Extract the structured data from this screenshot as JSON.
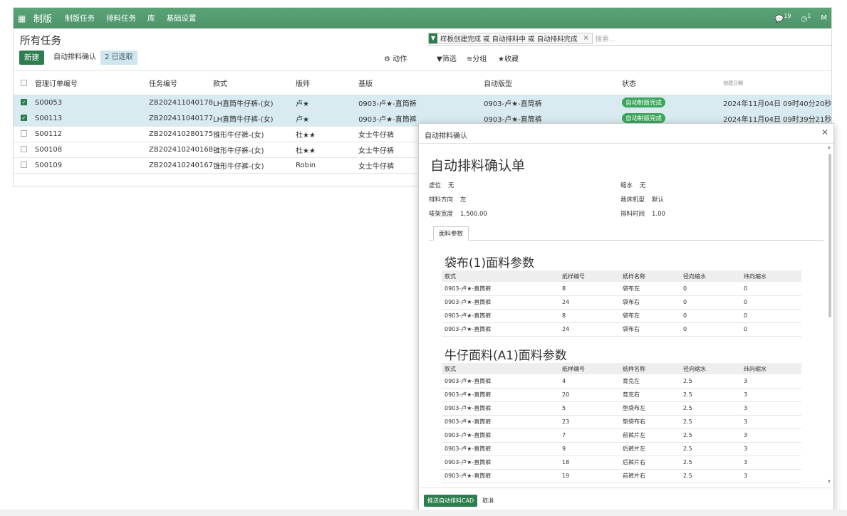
{
  "nav": {
    "brand": "制版",
    "items": [
      "制版任务",
      "排料任务",
      "库",
      "基础设置"
    ],
    "messages_count": "19",
    "activity_count": "1",
    "user_initial": "M"
  },
  "control": {
    "title": "所有任务",
    "new_label": "新建",
    "auto_confirm_label": "自动排料确认",
    "selected_label": "2 已选取",
    "action_label": "动作",
    "filter_label": "筛选",
    "group_label": "分组",
    "favorite_label": "收藏",
    "facet_text": "样板创建完成 或 自动排料中 或 自动排料完成",
    "search_placeholder": "搜索..."
  },
  "list": {
    "columns": [
      "管理订单编号",
      "任务编号",
      "款式",
      "版师",
      "基版",
      "自动版型",
      "状态",
      "创建日期"
    ],
    "rows": [
      {
        "selected": true,
        "order": "S00053",
        "task": "ZB202411040178",
        "style": "LH直筒牛仔裤-(女)",
        "maker": "卢★",
        "base": "0903-卢★-直筒裤",
        "auto": "0903-卢★-直筒裤",
        "status": "自动制版完成",
        "date": "2024年11月04日 09时40分20秒"
      },
      {
        "selected": true,
        "order": "S00113",
        "task": "ZB202411040177",
        "style": "LH直筒牛仔裤-(女)",
        "maker": "卢★",
        "base": "0903-卢★-直筒裤",
        "auto": "0903-卢★-直筒裤",
        "status": "自动制版完成",
        "date": "2024年11月04日 09时39分21秒"
      },
      {
        "selected": false,
        "order": "S00112",
        "task": "ZB202410280175",
        "style": "锥形牛仔裤-(女)",
        "maker": "杜★★",
        "base": "女士牛仔裤",
        "auto": "",
        "status": "",
        "date": ""
      },
      {
        "selected": false,
        "order": "S00108",
        "task": "ZB202410240168",
        "style": "锥形牛仔裤-(女)",
        "maker": "杜★★",
        "base": "女士牛仔裤",
        "auto": "",
        "status": "",
        "date": ""
      },
      {
        "selected": false,
        "order": "S00109",
        "task": "ZB202410240167",
        "style": "锥形牛仔裤-(女)",
        "maker": "Robin",
        "base": "女士牛仔裤",
        "auto": "",
        "status": "",
        "date": ""
      }
    ]
  },
  "modal": {
    "title": "自动排料确认",
    "sheet_title": "自动排料确认单",
    "fields": {
      "virtual_label": "虚位",
      "virtual_value": "无",
      "shrink_label": "缩水",
      "shrink_value": "无",
      "direction_label": "排料方向",
      "direction_value": "左",
      "cutter_label": "裁床机型",
      "cutter_value": "默认",
      "width_label": "唛架宽度",
      "width_value": "1,500.00",
      "time_label": "排料时间",
      "time_value": "1.00"
    },
    "tab_label": "面料参数",
    "section1_title": "袋布(1)面料参数",
    "section2_title": "牛仔面料(A1)面料参数",
    "table_columns": [
      "款式",
      "纸样编号",
      "纸样名称",
      "径向缩水",
      "纬向缩水"
    ],
    "section1_rows": [
      [
        "0903-卢★-直筒裤",
        "8",
        "袋布左",
        "0",
        "0"
      ],
      [
        "0903-卢★-直筒裤",
        "24",
        "袋布右",
        "0",
        "0"
      ],
      [
        "0903-卢★-直筒裤",
        "8",
        "袋布左",
        "0",
        "0"
      ],
      [
        "0903-卢★-直筒裤",
        "24",
        "袋布右",
        "0",
        "0"
      ]
    ],
    "section2_rows": [
      [
        "0903-卢★-直筒裤",
        "4",
        "育克左",
        "2.5",
        "3"
      ],
      [
        "0903-卢★-直筒裤",
        "20",
        "育克右",
        "2.5",
        "3"
      ],
      [
        "0903-卢★-直筒裤",
        "5",
        "垫袋布左",
        "2.5",
        "3"
      ],
      [
        "0903-卢★-直筒裤",
        "23",
        "垫袋布右",
        "2.5",
        "3"
      ],
      [
        "0903-卢★-直筒裤",
        "7",
        "前裤片左",
        "2.5",
        "3"
      ],
      [
        "0903-卢★-直筒裤",
        "9",
        "后裤片左",
        "2.5",
        "3"
      ],
      [
        "0903-卢★-直筒裤",
        "18",
        "后裤片右",
        "2.5",
        "3"
      ],
      [
        "0903-卢★-直筒裤",
        "19",
        "前裤片右",
        "2.5",
        "3"
      ]
    ],
    "push_label": "推送自动排料CAD",
    "cancel_label": "取消"
  }
}
